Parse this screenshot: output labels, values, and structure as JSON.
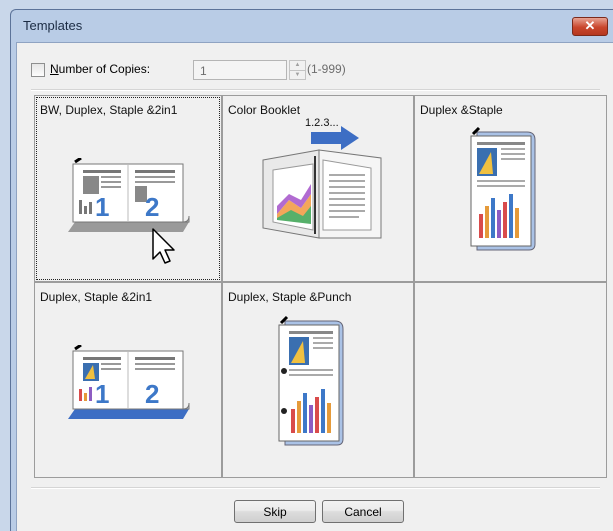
{
  "window": {
    "title": "Templates",
    "close_glyph": "✕"
  },
  "copies": {
    "checked": false,
    "label_accel": "N",
    "label_rest": "umber of Copies:",
    "value": "1",
    "range": "(1-999)"
  },
  "templates": [
    {
      "label": "BW, Duplex, Staple &2in1",
      "selected": true
    },
    {
      "label": "Color Booklet",
      "overlay": "1.2.3..."
    },
    {
      "label": "Duplex &Staple"
    },
    {
      "label": "Duplex, Staple &2in1"
    },
    {
      "label": "Duplex, Staple &Punch"
    },
    {
      "label": ""
    }
  ],
  "thumb_numbers": {
    "one": "1",
    "two": "2"
  },
  "buttons": {
    "skip": "Skip",
    "cancel": "Cancel"
  },
  "colors": {
    "accent_blue": "#3d78c8",
    "close_red": "#c9462c",
    "frame": "#b9cce6"
  }
}
